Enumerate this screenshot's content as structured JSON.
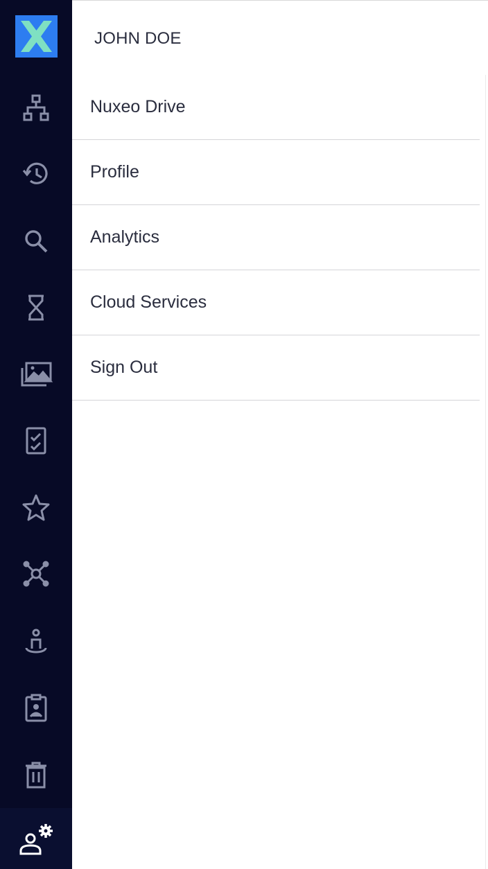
{
  "user": {
    "name": "JOHN DOE"
  },
  "menu": {
    "items": [
      {
        "label": "Nuxeo Drive"
      },
      {
        "label": "Profile"
      },
      {
        "label": "Analytics"
      },
      {
        "label": "Cloud Services"
      },
      {
        "label": "Sign Out"
      }
    ]
  },
  "sidebar": {
    "logo": "nuxeo-logo",
    "icons": [
      "browse-tree-icon",
      "history-icon",
      "search-icon",
      "expired-hourglass-icon",
      "collections-icon",
      "tasks-icon",
      "favorites-star-icon",
      "network-icon",
      "personal-workspace-icon",
      "administration-clipboard-icon",
      "trash-icon",
      "user-settings-icon"
    ]
  },
  "colors": {
    "sidebar_bg": "#070a26",
    "logo_bg": "#2d7df0",
    "logo_x": "#7fe0c2",
    "icon": "#8a8fa8",
    "active_icon": "#ffffff",
    "text": "#2a2d3e"
  }
}
